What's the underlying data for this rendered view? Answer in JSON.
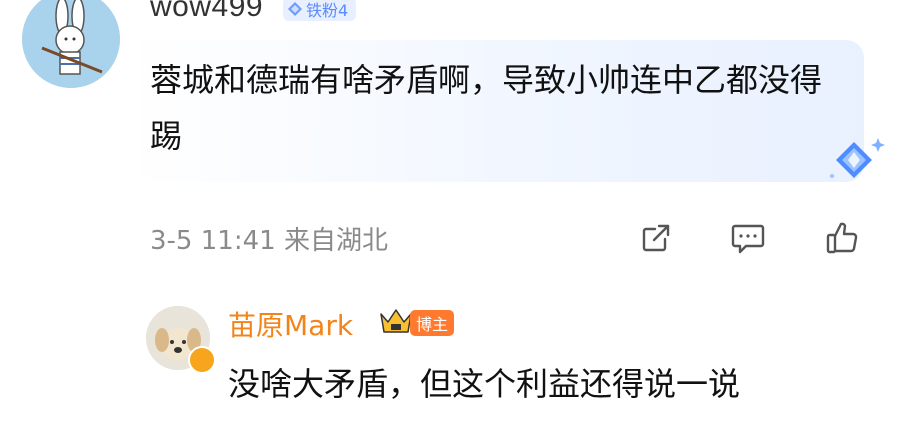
{
  "comment": {
    "username": "wow499",
    "badge_label": "铁粉4",
    "text": "蓉城和德瑞有啥矛盾啊，导致小帅连中乙都没得踢",
    "timestamp": "3-5 11:41",
    "location": "来自湖北",
    "avatar_icon": "rabbit-avatar-icon",
    "badge_icon": "diamond-icon",
    "actions": [
      "share-icon",
      "comment-icon",
      "like-icon"
    ]
  },
  "reply": {
    "username": "苗原Mark",
    "badge_label": "博主",
    "text": "没啥大矛盾，但这个利益还得说一说",
    "avatar_icon": "dog-avatar-icon",
    "verified_icon": "verified-badge-icon",
    "crown_icon": "crown-icon"
  },
  "colors": {
    "accent_blue": "#5b8bff",
    "reply_name": "#f28419",
    "host_badge": "#ff7a2e",
    "meta_gray": "#8a8a8a"
  }
}
